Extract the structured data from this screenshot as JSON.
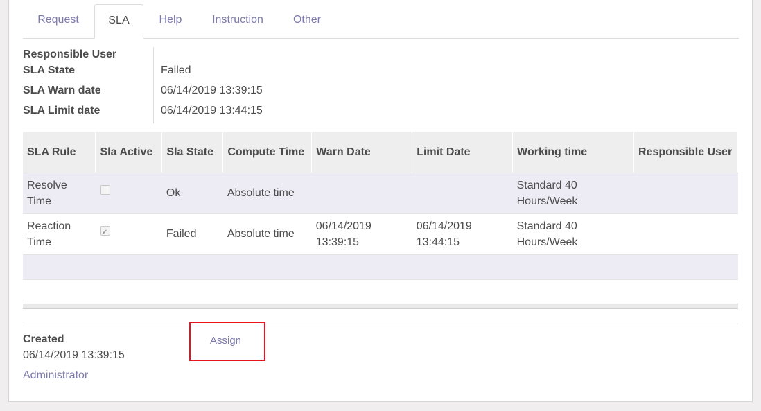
{
  "tabs": [
    {
      "label": "Request"
    },
    {
      "label": "SLA"
    },
    {
      "label": "Help"
    },
    {
      "label": "Instruction"
    },
    {
      "label": "Other"
    }
  ],
  "active_tab": "SLA",
  "fields": {
    "responsible_user_label": "Responsible User",
    "responsible_user_value": "",
    "sla_state_label": "SLA State",
    "sla_state_value": "Failed",
    "sla_warn_label": "SLA Warn date",
    "sla_warn_value": "06/14/2019 13:39:15",
    "sla_limit_label": "SLA Limit date",
    "sla_limit_value": "06/14/2019 13:44:15"
  },
  "table": {
    "headers": [
      "SLA Rule",
      "Sla Active",
      "Sla State",
      "Compute Time",
      "Warn Date",
      "Limit Date",
      "Working time",
      "Responsible User"
    ],
    "rows": [
      {
        "rule": "Resolve Time",
        "active": false,
        "state": "Ok",
        "compute": "Absolute time",
        "warn": "",
        "limit": "",
        "working": "Standard 40 Hours/Week",
        "responsible": ""
      },
      {
        "rule": "Reaction Time",
        "active": true,
        "state": "Failed",
        "compute": "Absolute time",
        "warn": "06/14/2019 13:39:15",
        "limit": "06/14/2019 13:44:15",
        "working": "Standard 40 Hours/Week",
        "responsible": ""
      }
    ]
  },
  "footer": {
    "created_label": "Created",
    "created_date": "06/14/2019 13:39:15",
    "created_by": "Administrator",
    "assign_label": "Assign"
  },
  "colors": {
    "link": "#7c7bad",
    "highlight_box": "#e8141c",
    "row_stripe": "#edecf5"
  }
}
